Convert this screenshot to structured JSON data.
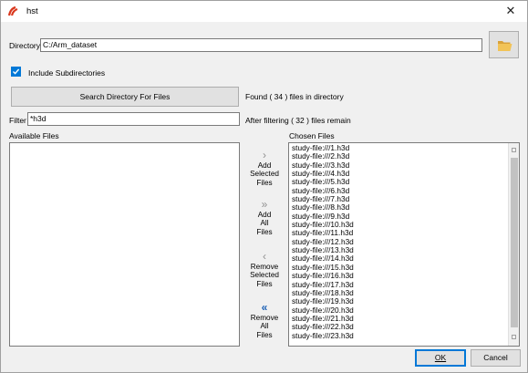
{
  "window": {
    "title": "hst"
  },
  "directory": {
    "label": "Directory",
    "value": "C:/Arm_dataset"
  },
  "include_subdirectories": {
    "label": "Include Subdirectories",
    "checked": true
  },
  "search_button": {
    "label": "Search Directory For Files"
  },
  "found_text": "Found ( 34 ) files in directory",
  "filter": {
    "label": "Filter",
    "value": "*h3d"
  },
  "filter_result_text": "After filtering ( 32 ) files remain",
  "available_files": {
    "label": "Available Files",
    "items": []
  },
  "chosen_files": {
    "label": "Chosen Files",
    "items": [
      "study-file:///1.h3d",
      "study-file:///2.h3d",
      "study-file:///3.h3d",
      "study-file:///4.h3d",
      "study-file:///5.h3d",
      "study-file:///6.h3d",
      "study-file:///7.h3d",
      "study-file:///8.h3d",
      "study-file:///9.h3d",
      "study-file:///10.h3d",
      "study-file:///11.h3d",
      "study-file:///12.h3d",
      "study-file:///13.h3d",
      "study-file:///14.h3d",
      "study-file:///15.h3d",
      "study-file:///16.h3d",
      "study-file:///17.h3d",
      "study-file:///18.h3d",
      "study-file:///19.h3d",
      "study-file:///20.h3d",
      "study-file:///21.h3d",
      "study-file:///22.h3d",
      "study-file:///23.h3d"
    ]
  },
  "actions": {
    "add_selected": {
      "icon": "›",
      "l1": "Add",
      "l2": "Selected",
      "l3": "Files"
    },
    "add_all": {
      "icon": "»",
      "l1": "Add",
      "l2": "All",
      "l3": "Files"
    },
    "remove_selected": {
      "icon": "‹",
      "l1": "Remove",
      "l2": "Selected",
      "l3": "Files"
    },
    "remove_all": {
      "icon": "«",
      "l1": "Remove",
      "l2": "All",
      "l3": "Files"
    }
  },
  "ok_button": {
    "label": "OK"
  },
  "cancel_button": {
    "label": "Cancel"
  },
  "icons": {
    "app": "app-logo-icon",
    "close": "close-icon",
    "folder": "folder-open-icon",
    "check": "check-icon"
  },
  "colors": {
    "accent": "#0078d7",
    "folder": "#e8b54a"
  }
}
